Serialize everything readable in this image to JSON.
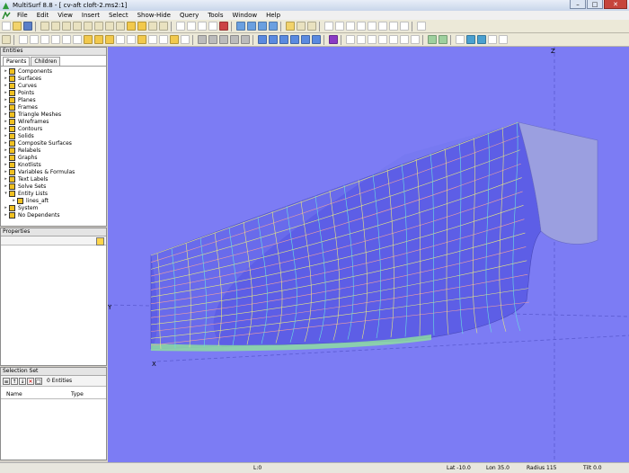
{
  "window": {
    "title": "MultiSurf 8.8 - [ cv-aft cloft-2.ms2:1]",
    "min": "–",
    "max": "□",
    "close": "✕"
  },
  "menu": [
    "File",
    "Edit",
    "View",
    "Insert",
    "Select",
    "Show-Hide",
    "Query",
    "Tools",
    "Window",
    "Help"
  ],
  "entities_panel": {
    "title": "Entities",
    "tabs": [
      "Parents",
      "Children"
    ],
    "tree": [
      {
        "label": "Components",
        "color": "#f0c020"
      },
      {
        "label": "Surfaces",
        "color": "#f0c020"
      },
      {
        "label": "Curves",
        "color": "#f0c020"
      },
      {
        "label": "Points",
        "color": "#f0c020"
      },
      {
        "label": "Planes",
        "color": "#f0c020"
      },
      {
        "label": "Frames",
        "color": "#f0c020"
      },
      {
        "label": "Triangle Meshes",
        "color": "#f0c020"
      },
      {
        "label": "Wireframes",
        "color": "#f0c020"
      },
      {
        "label": "Contours",
        "color": "#f0c020"
      },
      {
        "label": "Solids",
        "color": "#f0c020"
      },
      {
        "label": "Composite Surfaces",
        "color": "#f0c020"
      },
      {
        "label": "Relabels",
        "color": "#f0c020"
      },
      {
        "label": "Graphs",
        "color": "#f0c020"
      },
      {
        "label": "Knotlists",
        "color": "#f0c020"
      },
      {
        "label": "Variables & Formulas",
        "color": "#f0c020"
      },
      {
        "label": "Text Labels",
        "color": "#f0c020"
      },
      {
        "label": "Solve Sets",
        "color": "#f0c020"
      },
      {
        "label": "Entity Lists",
        "color": "#f0c020"
      },
      {
        "label": "lines_aft",
        "color": "#f0c020",
        "child": true
      },
      {
        "label": "System",
        "color": "#f0c020"
      },
      {
        "label": "No Dependents",
        "color": "#f0c020"
      }
    ]
  },
  "properties_panel": {
    "title": "Properties"
  },
  "selection_panel": {
    "title": "Selection Set",
    "count_label": "0 Entities",
    "columns": [
      "Name",
      "Type"
    ]
  },
  "viewport": {
    "background": "#7c7cf4",
    "axis_labels": {
      "z": "Z",
      "y": "Y",
      "x": "X"
    }
  },
  "status": {
    "layer": "L:0",
    "lat": "Lat -10.0",
    "lon": "Lon 35.0",
    "radius": "Radius 115",
    "tilt": "Tilt 0.0"
  }
}
